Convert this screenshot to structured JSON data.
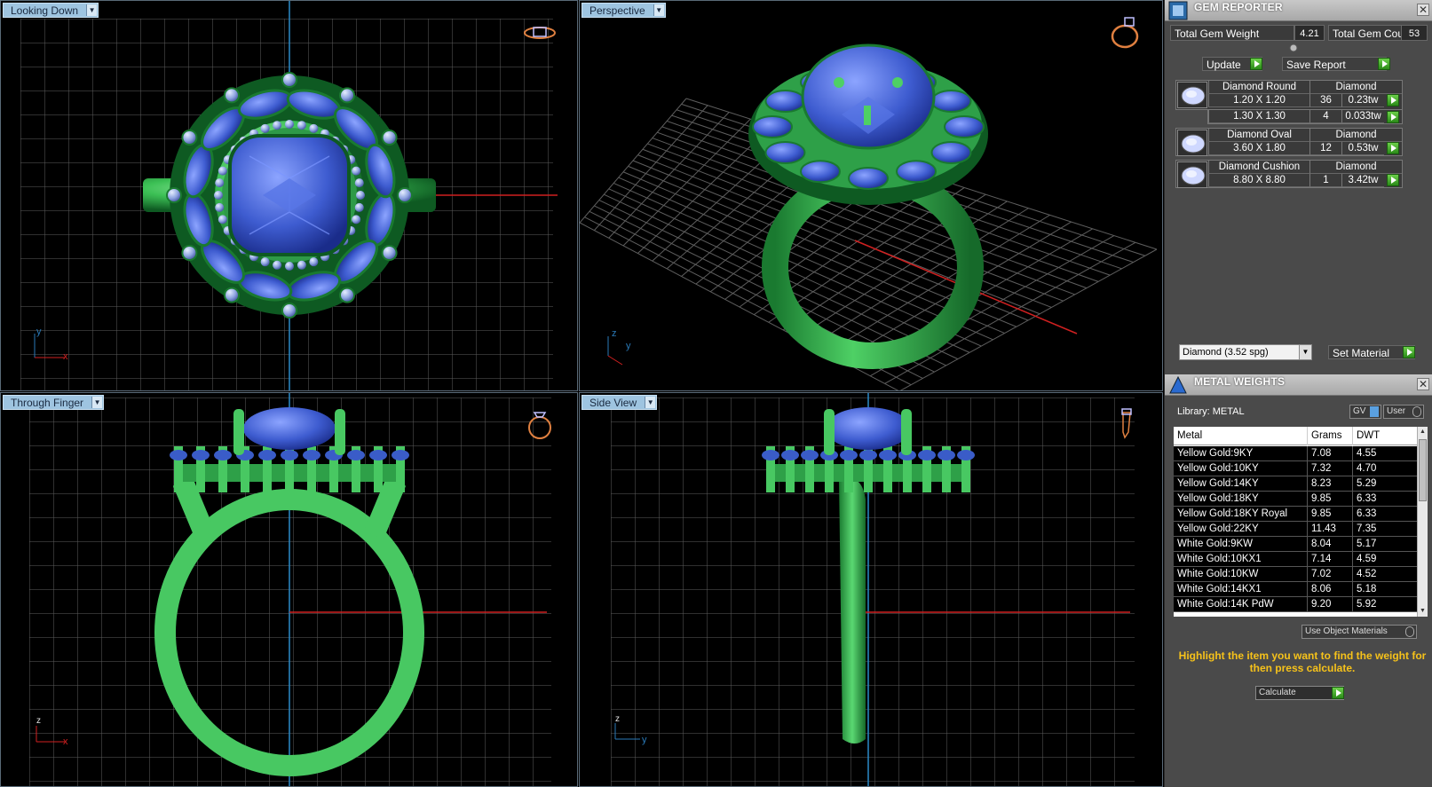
{
  "viewports": [
    {
      "id": "top-left",
      "title": "Looking Down",
      "axis_v": "y",
      "axis_h": "x"
    },
    {
      "id": "top-right",
      "title": "Perspective",
      "axis_v": "z",
      "axis_h": "y"
    },
    {
      "id": "bottom-left",
      "title": "Through Finger",
      "axis_v": "z",
      "axis_h": "x"
    },
    {
      "id": "bottom-right",
      "title": "Side View",
      "axis_v": "z",
      "axis_h": "y"
    }
  ],
  "gem_reporter": {
    "title": "GEM REPORTER",
    "total_weight_label": "Total Gem Weight",
    "total_weight": "4.21",
    "total_count_label": "Total Gem Count",
    "total_count": "53",
    "update_label": "Update",
    "save_report_label": "Save Report",
    "groups": [
      {
        "name": "Diamond Round",
        "material": "Diamond",
        "rows": [
          {
            "size": "1.20 X 1.20",
            "count": "36",
            "weight": "0.23tw"
          },
          {
            "size": "1.30 X 1.30",
            "count": "4",
            "weight": "0.033tw"
          }
        ]
      },
      {
        "name": "Diamond Oval",
        "material": "Diamond",
        "rows": [
          {
            "size": "3.60 X 1.80",
            "count": "12",
            "weight": "0.53tw"
          }
        ]
      },
      {
        "name": "Diamond Cushion",
        "material": "Diamond",
        "rows": [
          {
            "size": "8.80 X 8.80",
            "count": "1",
            "weight": "3.42tw"
          }
        ]
      }
    ],
    "material_select": "Diamond    (3.52 spg)",
    "set_material_label": "Set Material"
  },
  "metal_weights": {
    "title": "METAL WEIGHTS",
    "library_label": "Library: METAL",
    "gv_label": "GV",
    "user_label": "User",
    "columns": [
      "Metal",
      "Grams",
      "DWT"
    ],
    "rows": [
      [
        "Yellow Gold:9KY",
        "7.08",
        "4.55"
      ],
      [
        "Yellow Gold:10KY",
        "7.32",
        "4.70"
      ],
      [
        "Yellow Gold:14KY",
        "8.23",
        "5.29"
      ],
      [
        "Yellow Gold:18KY",
        "9.85",
        "6.33"
      ],
      [
        "Yellow Gold:18KY Royal",
        "9.85",
        "6.33"
      ],
      [
        "Yellow Gold:22KY",
        "11.43",
        "7.35"
      ],
      [
        "White Gold:9KW",
        "8.04",
        "5.17"
      ],
      [
        "White Gold:10KX1",
        "7.14",
        "4.59"
      ],
      [
        "White Gold:10KW",
        "7.02",
        "4.52"
      ],
      [
        "White Gold:14KX1",
        "8.06",
        "5.18"
      ],
      [
        "White Gold:14K PdW",
        "9.20",
        "5.92"
      ]
    ],
    "use_object_materials_label": "Use Object Materials",
    "hint": "Highlight the item you want to find the weight for then press calculate.",
    "calculate_label": "Calculate"
  },
  "colors": {
    "grid": "#6a6a6a",
    "metal": "#3fbf55",
    "gem": "#3a5cc8",
    "accent_hint": "#f6c21a",
    "axis_x": "#d02020",
    "axis_y": "#2a7ab8"
  }
}
